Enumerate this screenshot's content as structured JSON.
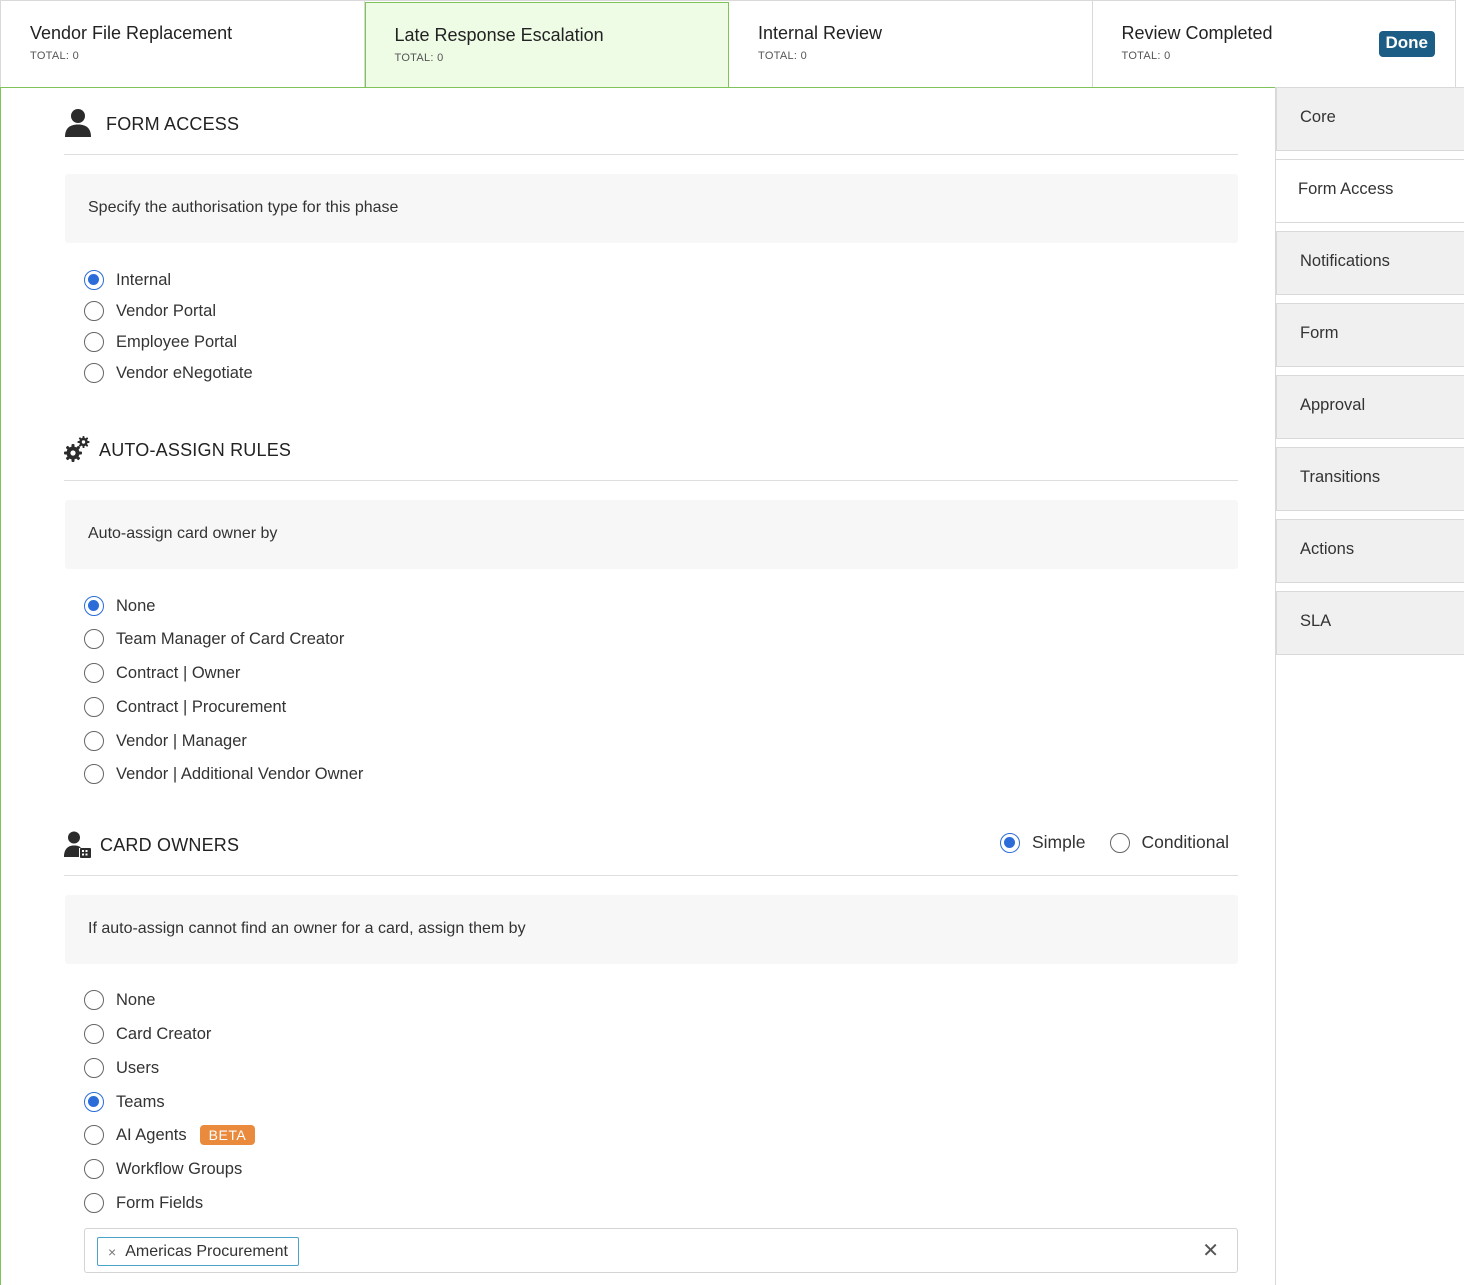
{
  "phases": [
    {
      "title": "Vendor File Replacement",
      "total": "TOTAL: 0"
    },
    {
      "title": "Late Response Escalation",
      "total": "TOTAL: 0"
    },
    {
      "title": "Internal Review",
      "total": "TOTAL: 0"
    },
    {
      "title": "Review Completed",
      "total": "TOTAL: 0",
      "badge": "Done"
    }
  ],
  "form_access": {
    "title": "FORM ACCESS",
    "description": "Specify the authorisation type for this phase",
    "options": [
      "Internal",
      "Vendor Portal",
      "Employee Portal",
      "Vendor eNegotiate"
    ],
    "selected": "Internal"
  },
  "auto_assign": {
    "title": "AUTO-ASSIGN RULES",
    "description": "Auto-assign card owner by",
    "options": [
      "None",
      "Team Manager of Card Creator",
      "Contract | Owner",
      "Contract | Procurement",
      "Vendor | Manager",
      "Vendor | Additional Vendor Owner"
    ],
    "selected": "None"
  },
  "card_owners": {
    "title": "CARD OWNERS",
    "mode_options": [
      "Simple",
      "Conditional"
    ],
    "mode_selected": "Simple",
    "description": "If auto-assign cannot find an owner for a card, assign them by",
    "options": [
      "None",
      "Card Creator",
      "Users",
      "Teams",
      "AI Agents",
      "Workflow Groups",
      "Form Fields"
    ],
    "selected": "Teams",
    "beta_label": "BETA",
    "selected_tags": [
      "Americas Procurement"
    ],
    "tag_remove_glyph": "×",
    "clear_glyph": "✕"
  },
  "sidebar": {
    "items": [
      "Core",
      "Form Access",
      "Notifications",
      "Form",
      "Approval",
      "Transitions",
      "Actions",
      "SLA"
    ],
    "active": "Form Access"
  },
  "colors": {
    "accent_blue": "#2b6cd8",
    "active_phase_bg": "#eefbe5",
    "active_phase_border": "#7ec45a",
    "done_badge": "#1c5d85",
    "beta_badge": "#e98a3d"
  }
}
